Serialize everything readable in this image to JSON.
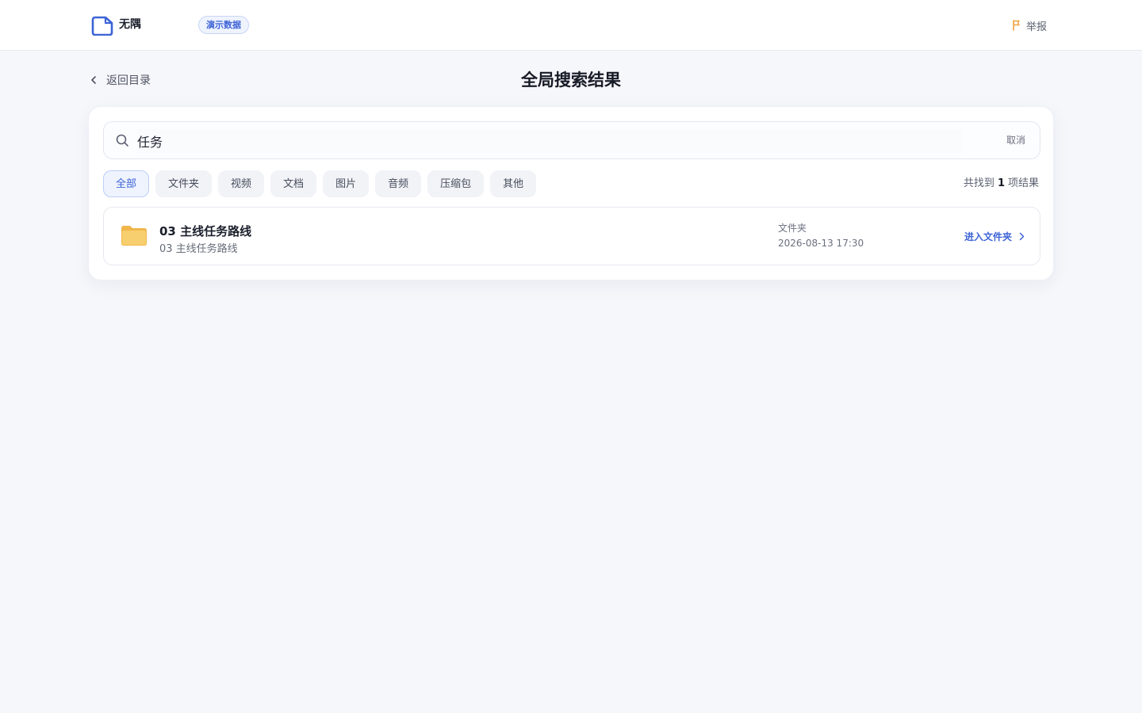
{
  "header": {
    "app_name": "无隅",
    "demo_badge": "演示数据",
    "report_label": "举报"
  },
  "nav": {
    "back_label": "返回目录",
    "page_title": "全局搜索结果"
  },
  "search": {
    "query": "任务",
    "cancel_label": "取消"
  },
  "filters": {
    "items": [
      "全部",
      "文件夹",
      "视频",
      "文档",
      "图片",
      "音频",
      "压缩包",
      "其他"
    ],
    "active_index": 0
  },
  "results_summary": {
    "prefix": "共找到",
    "count": "1",
    "suffix": "项结果"
  },
  "results": [
    {
      "name": "03 主线任务路线",
      "path": "03 主线任务路线",
      "type": "文件夹",
      "date": "2026-08-13 17:30",
      "action_label": "进入文件夹"
    }
  ],
  "colors": {
    "accent": "#3d63d6",
    "background": "#f6f7fb",
    "folder": "#f5c560",
    "report_flag": "#f0a23c"
  },
  "icons": {
    "logo": "file-icon",
    "report": "flag-icon",
    "back": "chevron-left-icon",
    "search": "search-icon",
    "folder": "folder-icon",
    "enter": "chevron-right-icon"
  }
}
